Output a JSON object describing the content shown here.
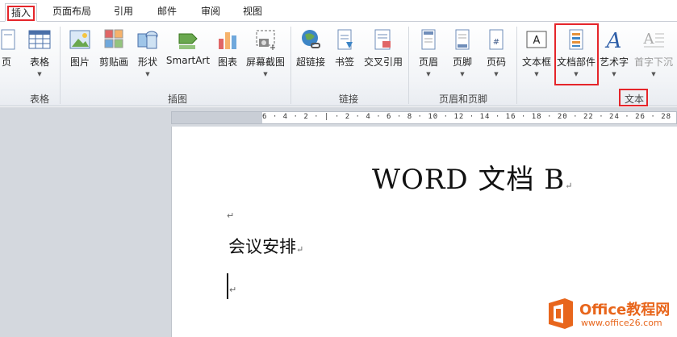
{
  "tabs": [
    "插入",
    "页面布局",
    "引用",
    "邮件",
    "审阅",
    "视图"
  ],
  "ribbon": {
    "cut_left_label": "页",
    "table": "表格",
    "picture": "图片",
    "clipart": "剪贴画",
    "shapes": "形状",
    "smartart": "SmartArt",
    "chart": "图表",
    "screenshot": "屏幕截图",
    "hyperlink": "超链接",
    "bookmark": "书签",
    "crossref": "交叉引用",
    "header": "页眉",
    "footer": "页脚",
    "pagenum": "页码",
    "textbox": "文本框",
    "quickparts": "文档部件",
    "wordart": "艺术字",
    "dropcap": "首字下沉",
    "dropdown_glyph": "▼"
  },
  "groups": {
    "tables": "表格",
    "illustrations": "插图",
    "links": "链接",
    "headerfooter": "页眉和页脚",
    "text": "文本"
  },
  "ruler_text": "6 · 4 · 2 · | · 2 · 4 · 6 · 8 · 10 · 12 · 14 · 16 · 18 · 20 · 22 · 24 · 26 · 28 ·",
  "document": {
    "title": "WORD 文档 B",
    "heading": "会议安排",
    "para_mark": "↵"
  },
  "watermark": {
    "brand": "Office教程网",
    "url": "www.office26.com"
  },
  "colors": {
    "highlight_red": "#e5252a",
    "brand_orange": "#e8661c"
  }
}
